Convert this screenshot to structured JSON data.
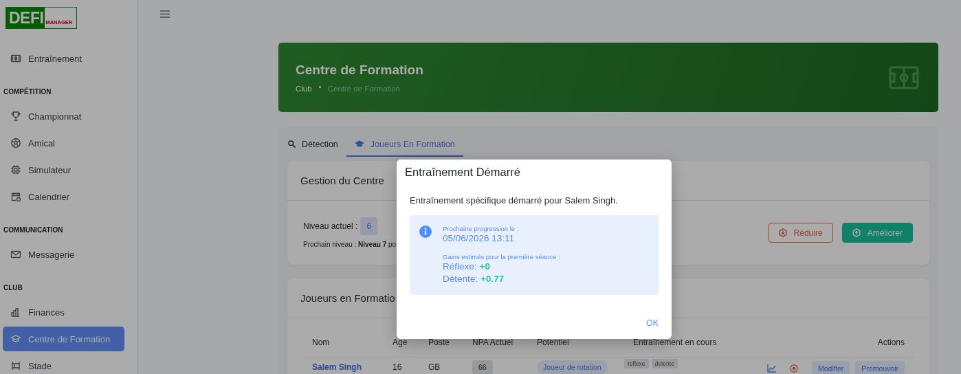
{
  "sidebar": {
    "logo": {
      "primary": "DEFI",
      "secondary": "MANAGER"
    },
    "entries": [
      {
        "kind": "item",
        "label": "Entraînement",
        "selected": false
      },
      {
        "kind": "section",
        "label": "COMPÉTITION"
      },
      {
        "kind": "item",
        "label": "Championnat",
        "selected": false
      },
      {
        "kind": "item",
        "label": "Amical",
        "selected": false
      },
      {
        "kind": "item",
        "label": "Simulateur",
        "selected": false
      },
      {
        "kind": "item",
        "label": "Calendrier",
        "selected": false
      },
      {
        "kind": "section",
        "label": "COMMUNICATION"
      },
      {
        "kind": "item",
        "label": "Messagerie",
        "selected": false
      },
      {
        "kind": "section",
        "label": "CLUB"
      },
      {
        "kind": "item",
        "label": "Finances",
        "selected": false
      },
      {
        "kind": "item",
        "label": "Centre de Formation",
        "selected": true
      },
      {
        "kind": "item",
        "label": "Stade",
        "selected": false
      }
    ]
  },
  "banner": {
    "title": "Centre de Formation",
    "breadcrumb": [
      "Club",
      "Centre de Formation"
    ]
  },
  "tabs": [
    {
      "label": "Détection",
      "selected": false
    },
    {
      "label": "Joueurs En Formation",
      "selected": true
    }
  ],
  "center": {
    "title": "Gestion du Centre",
    "level_label": "Niveau actuel :",
    "level": "6",
    "next": "Prochain niveau : **Niveau 7** po",
    "buttons": [
      {
        "kind": "outline",
        "label": "Réduire"
      },
      {
        "kind": "solid",
        "label": "Améliorer"
      }
    ]
  },
  "players": {
    "title": "Joueurs en Formatio",
    "columns": [
      "Nom",
      "Age",
      "Poste",
      "NPA Actuel",
      "Potentiel",
      "Entraînement en cours",
      "Actions"
    ],
    "rows": [
      {
        "name": "Salem Singh",
        "age": "16",
        "position": "GB",
        "npa": "66",
        "potential": "Joueur de rotation",
        "training": [
          "reflexe",
          "detente"
        ],
        "actions": [
          "Modifier",
          "Promouvoir"
        ]
      }
    ]
  },
  "dialog": {
    "title": "Entraînement Démarré",
    "message": "Entraînement spécifique démarré pour Salem Singh.",
    "info": {
      "next_label": "Prochaine progression le :",
      "next_date": "05/06/2026 13:11",
      "gains_label": "Gains estimés pour la première séance :",
      "gains": [
        {
          "stat": "Réflexe:",
          "value": "+0"
        },
        {
          "stat": "Détente:",
          "value": "+0.77"
        }
      ]
    },
    "button": "OK"
  }
}
